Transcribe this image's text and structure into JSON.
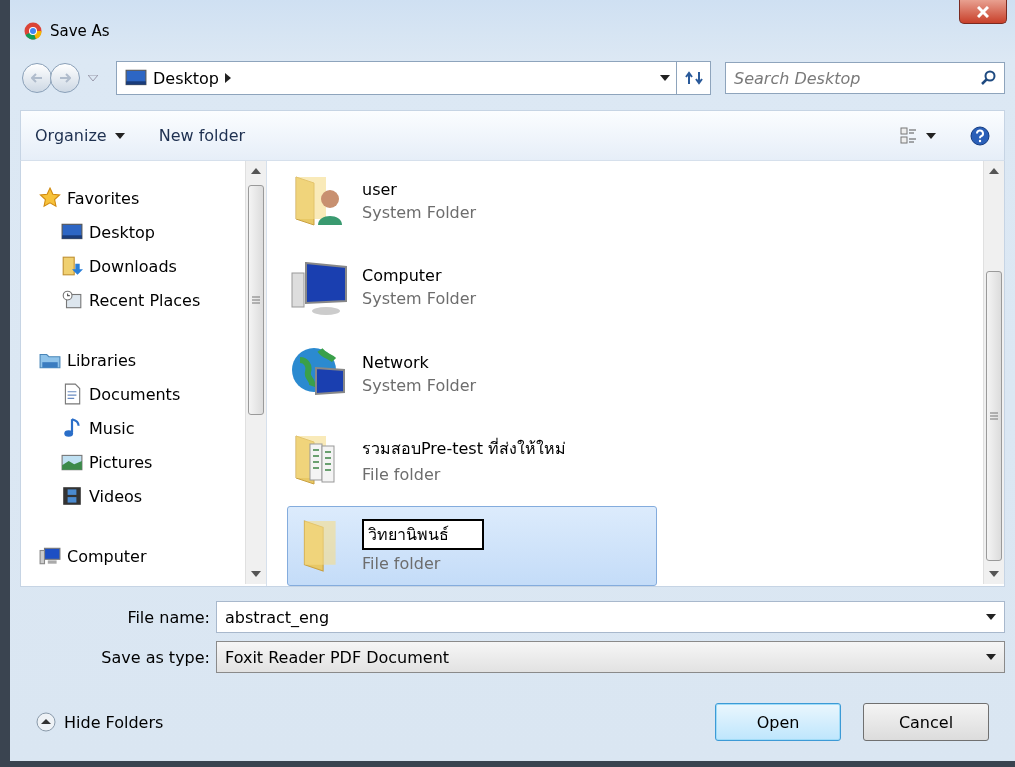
{
  "window": {
    "title": "Save As"
  },
  "address_bar": {
    "path": "Desktop"
  },
  "search": {
    "placeholder": "Search Desktop"
  },
  "toolbar": {
    "organize": "Organize",
    "new_folder": "New folder"
  },
  "sidebar": {
    "items": [
      {
        "label": "Favorites",
        "children": [
          {
            "label": "Desktop"
          },
          {
            "label": "Downloads"
          },
          {
            "label": "Recent Places"
          }
        ]
      },
      {
        "label": "Libraries",
        "children": [
          {
            "label": "Documents"
          },
          {
            "label": "Music"
          },
          {
            "label": "Pictures"
          },
          {
            "label": "Videos"
          }
        ]
      },
      {
        "label": "Computer"
      }
    ]
  },
  "files": [
    {
      "name": "user",
      "type": "System Folder",
      "selected": false,
      "editing": false
    },
    {
      "name": "Computer",
      "type": "System Folder",
      "selected": false,
      "editing": false
    },
    {
      "name": "Network",
      "type": "System Folder",
      "selected": false,
      "editing": false
    },
    {
      "name": "รวมสอบPre-test ที่ส่งให้ใหม่",
      "type": "File folder",
      "selected": false,
      "editing": false
    },
    {
      "name": "วิทยานิพนธ์",
      "type": "File folder",
      "selected": true,
      "editing": true
    }
  ],
  "file_name": {
    "label": "File name:",
    "value": "abstract_eng"
  },
  "save_type": {
    "label": "Save as type:",
    "value": "Foxit Reader PDF Document"
  },
  "hide_folders": "Hide Folders",
  "buttons": [
    {
      "label": "Open",
      "default": true
    },
    {
      "label": "Cancel",
      "default": false
    }
  ]
}
